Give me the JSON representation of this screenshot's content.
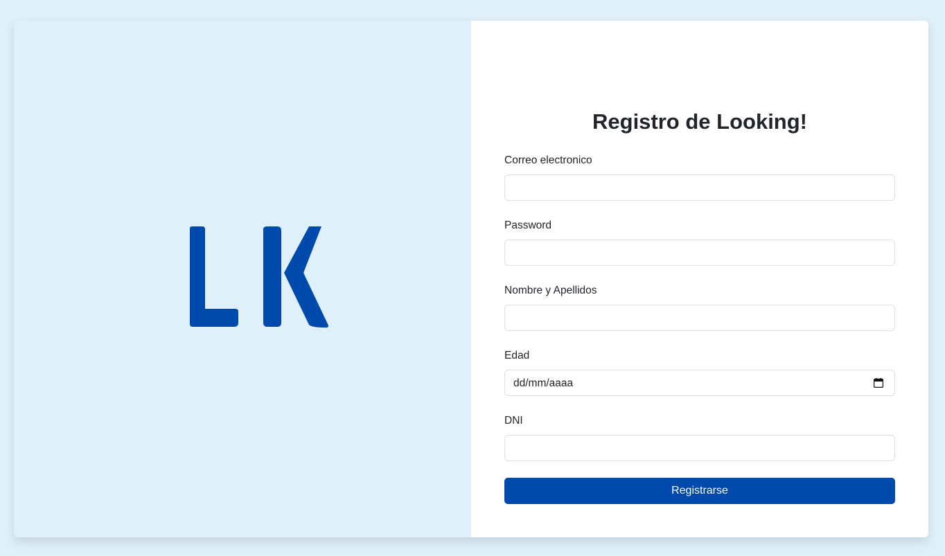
{
  "brand": {
    "logo_text": "LK",
    "logo_color": "#004aad",
    "panel_color": "#dff0fa"
  },
  "form": {
    "title": "Registro de Looking!",
    "fields": {
      "email": {
        "label": "Correo electronico",
        "value": ""
      },
      "password": {
        "label": "Password",
        "value": ""
      },
      "name": {
        "label": "Nombre y Apellidos",
        "value": ""
      },
      "age": {
        "label": "Edad",
        "placeholder": "dd/mm/aaaa",
        "icon": "calendar-icon"
      },
      "dni": {
        "label": "DNI",
        "value": ""
      }
    },
    "submit_label": "Registrarse",
    "accent_color": "#004aad"
  }
}
